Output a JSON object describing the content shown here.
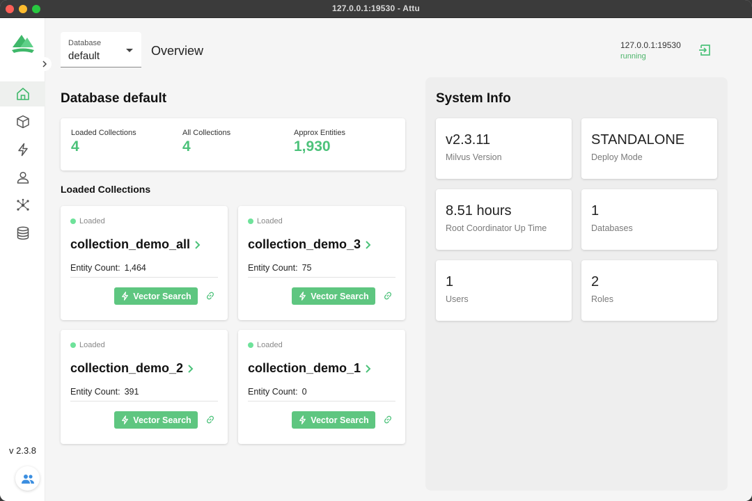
{
  "window": {
    "title": "127.0.0.1:19530 - Attu"
  },
  "sidebar": {
    "items": [
      {
        "name": "home",
        "icon": "home-icon",
        "active": true
      },
      {
        "name": "collections",
        "icon": "cube-icon",
        "active": false
      },
      {
        "name": "search",
        "icon": "lightning-icon",
        "active": false
      },
      {
        "name": "users",
        "icon": "person-icon",
        "active": false
      },
      {
        "name": "system",
        "icon": "network-icon",
        "active": false
      },
      {
        "name": "databases",
        "icon": "database-icon",
        "active": false
      }
    ],
    "version": "v 2.3.8"
  },
  "header": {
    "database_select": {
      "label": "Database",
      "value": "default"
    },
    "page_title": "Overview",
    "connection": {
      "address": "127.0.0.1:19530",
      "status": "running"
    }
  },
  "database_section": {
    "title": "Database default",
    "stats": [
      {
        "label": "Loaded Collections",
        "value": "4"
      },
      {
        "label": "All Collections",
        "value": "4"
      },
      {
        "label": "Approx Entities",
        "value": "1,930"
      }
    ],
    "loaded_title": "Loaded Collections",
    "collections": [
      {
        "status": "Loaded",
        "name": "collection_demo_all",
        "count_label": "Entity Count:",
        "count": "1,464",
        "button": "Vector Search"
      },
      {
        "status": "Loaded",
        "name": "collection_demo_3",
        "count_label": "Entity Count:",
        "count": "75",
        "button": "Vector Search"
      },
      {
        "status": "Loaded",
        "name": "collection_demo_2",
        "count_label": "Entity Count:",
        "count": "391",
        "button": "Vector Search"
      },
      {
        "status": "Loaded",
        "name": "collection_demo_1",
        "count_label": "Entity Count:",
        "count": "0",
        "button": "Vector Search"
      }
    ]
  },
  "system_info": {
    "title": "System Info",
    "cards": [
      {
        "value": "v2.3.11",
        "label": "Milvus Version"
      },
      {
        "value": "STANDALONE",
        "label": "Deploy Mode"
      },
      {
        "value": "8.51 hours",
        "label": "Root Coordinator Up Time"
      },
      {
        "value": "1",
        "label": "Databases"
      },
      {
        "value": "1",
        "label": "Users"
      },
      {
        "value": "2",
        "label": "Roles"
      }
    ]
  },
  "colors": {
    "accent": "#4cc27a",
    "button": "#5ec680",
    "status_running": "#4cb46a",
    "loaded_dot": "#6ee29a"
  }
}
